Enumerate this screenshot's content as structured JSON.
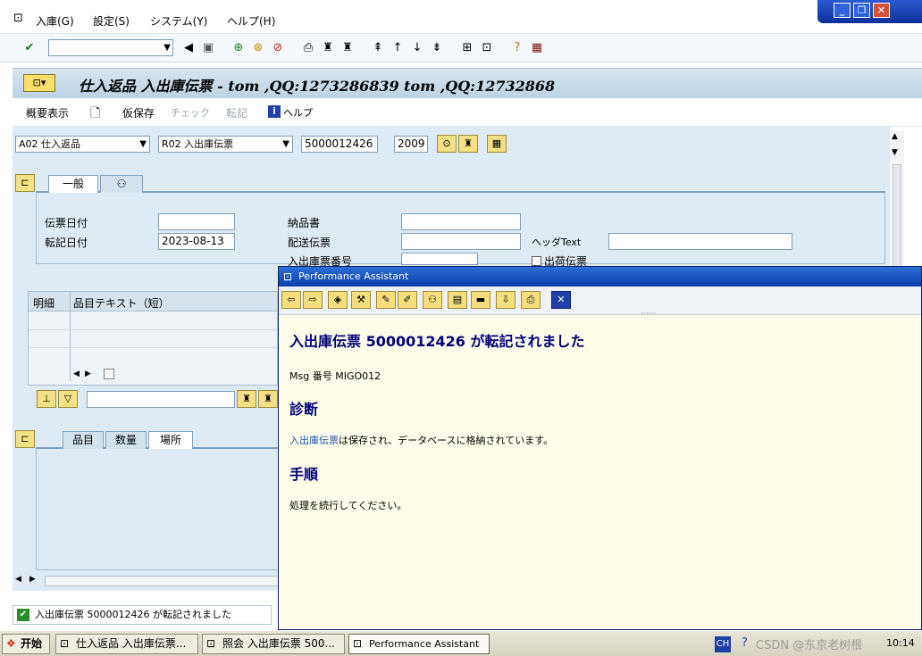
{
  "menubar": {
    "items": [
      "入庫(G)",
      "設定(S)",
      "システム(Y)",
      "ヘルプ(H)"
    ]
  },
  "title": {
    "text": "仕入返品 入出庫伝票 - tom ,QQ:1273286839 tom ,QQ:12732868"
  },
  "app_toolbar": {
    "summary": "概要表示",
    "hold": "仮保存",
    "check": "チェック",
    "post": "転記",
    "help": "ヘルプ"
  },
  "header_row": {
    "action": "A02 仕入返品",
    "ref": "R02 入出庫伝票",
    "doc_number": "5000012426",
    "year": "2009"
  },
  "general_tab": {
    "tab_label": "一般",
    "fields": {
      "doc_date_label": "伝票日付",
      "doc_date_value": "",
      "post_date_label": "転記日付",
      "post_date_value": "2023-08-13",
      "delivery_note_label": "納品書",
      "delivery_note_value": "",
      "bill_of_lading_label": "配送伝票",
      "bill_of_lading_value": "",
      "header_text_label": "ヘッダText",
      "header_text_value": "",
      "gr_slip_label": "入出庫票番号",
      "gr_slip_value": "",
      "outbound_checkbox_label": "出荷伝票"
    }
  },
  "item_table": {
    "columns": [
      "明細",
      "品目テキスト（短）"
    ]
  },
  "detail_tabs": [
    "品目",
    "数量",
    "場所"
  ],
  "status": {
    "message": "入出庫伝票 5000012426 が転記されました"
  },
  "popup": {
    "title": "Performance Assistant",
    "heading_prefix": "入出庫伝票",
    "heading_number": "5000012426",
    "heading_suffix": "が転記されました",
    "msg_label": "Msg 番号",
    "msg_value": "MIGO012",
    "diag_title": "診断",
    "diag_link": "入出庫伝票",
    "diag_text": "は保存され、データベースに格納されています。",
    "proc_title": "手順",
    "proc_text": "処理を続行してください。"
  },
  "taskbar": {
    "start": "开始",
    "tasks": [
      "仕入返品 入出庫伝票...",
      "照会 入出庫伝票 500...",
      "Performance Assistant"
    ],
    "lang": "CH",
    "watermark": "CSDN @东京老树根",
    "time": "10:14"
  }
}
